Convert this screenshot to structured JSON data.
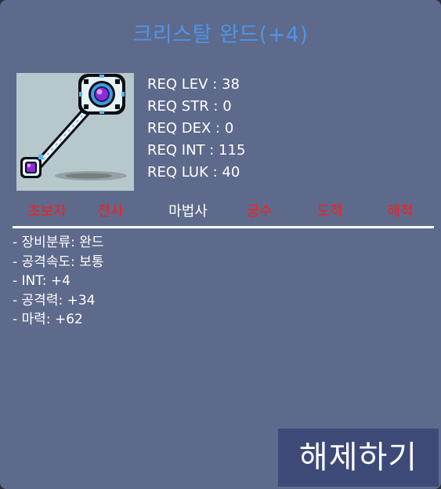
{
  "item": {
    "name": "크리스탈 완드(+4)",
    "icon": "crystal-wand-icon"
  },
  "requirements": [
    "REQ LEV : 38",
    "REQ STR : 0",
    "REQ DEX : 0",
    "REQ INT : 115",
    "REQ LUK : 40"
  ],
  "jobs": [
    {
      "label": "초보자",
      "color": "#ff1a1a"
    },
    {
      "label": "전사",
      "color": "#ff1a1a"
    },
    {
      "label": "마법사",
      "color": "#ffffff"
    },
    {
      "label": "궁수",
      "color": "#ff1a1a"
    },
    {
      "label": "도적",
      "color": "#ff1a1a"
    },
    {
      "label": "해적",
      "color": "#ff1a1a"
    }
  ],
  "stats": [
    "- 장비분류: 완드",
    "- 공격속도: 보통",
    "- INT: +4",
    "- 공격력: +34",
    "- 마력: +62"
  ],
  "actions": {
    "release_label": "해제하기"
  },
  "colors": {
    "panel": "#5d6a8b",
    "title": "#4f93e8",
    "disallowed_job": "#ff1a1a",
    "allowed_job": "#ffffff",
    "button": "#3d4a78"
  }
}
